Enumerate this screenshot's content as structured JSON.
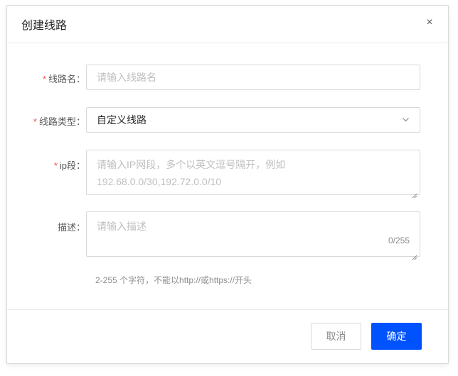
{
  "dialog": {
    "title": "创建线路",
    "close_label": "×"
  },
  "form": {
    "line_name": {
      "label": "线路名：",
      "required_mark": "*",
      "placeholder": "请输入线路名"
    },
    "line_type": {
      "label": "线路类型：",
      "required_mark": "*",
      "value": "自定义线路"
    },
    "ip_range": {
      "label": "ip段：",
      "required_mark": "*",
      "placeholder_line1": "请输入IP网段，多个以英文逗号隔开，例如",
      "placeholder_line2": "192.68.0.0/30,192.72.0.0/10"
    },
    "description": {
      "label": "描述：",
      "placeholder": "请输入描述",
      "counter": "0/255",
      "hint": "2-255 个字符，不能以http://或https://开头"
    }
  },
  "footer": {
    "cancel_label": "取消",
    "ok_label": "确定"
  },
  "colors": {
    "primary": "#0052ff",
    "required": "#ff4d4f"
  }
}
